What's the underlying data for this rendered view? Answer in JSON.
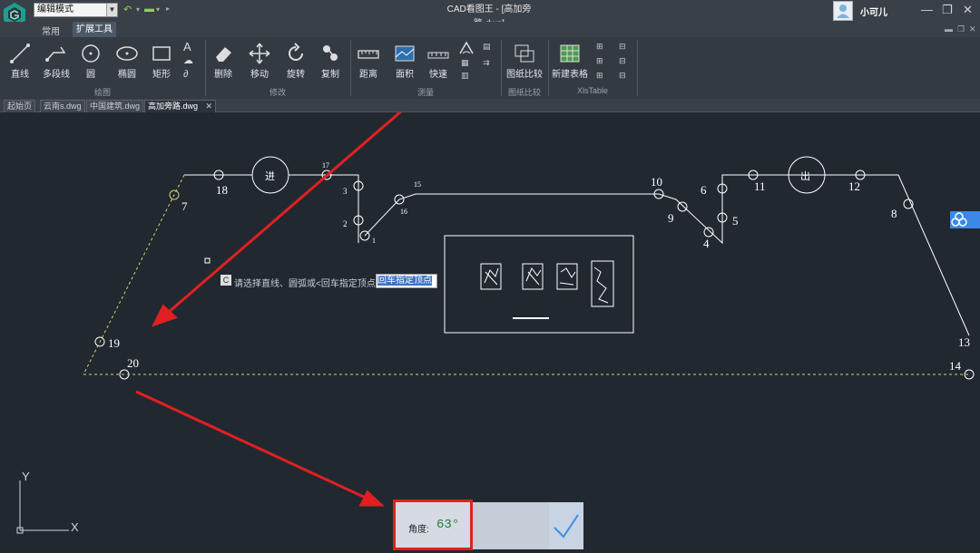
{
  "titlebar": {
    "mode_select": "编辑模式",
    "document_title": "CAD看图王 - [高加旁路.dwg]",
    "user_name": "小可儿"
  },
  "menu_tabs": [
    {
      "label": "常用"
    },
    {
      "label": "扩展工具"
    }
  ],
  "ribbon": {
    "draw_tools": [
      "直线",
      "多段线",
      "圆",
      "椭圆",
      "矩形"
    ],
    "modify_tools": [
      "删除",
      "移动",
      "旋转",
      "复制"
    ],
    "measure_tools": [
      "距离",
      "面积",
      "快速"
    ],
    "compare_tools": [
      "图纸比较"
    ],
    "table_tools": [
      "新建表格"
    ],
    "groups": [
      "绘图",
      "修改",
      "测量",
      "图纸比较",
      "XlsTable"
    ]
  },
  "document_tabs": [
    "起始页",
    "云南s.dwg",
    "中国建筑.dwg",
    "高加旁路.dwg"
  ],
  "drawing": {
    "entry_label": "进",
    "exit_label": "出",
    "point_labels": [
      "1",
      "2",
      "3",
      "4",
      "5",
      "6",
      "7",
      "8",
      "9",
      "10",
      "11",
      "12",
      "13",
      "14",
      "15",
      "16",
      "17",
      "18",
      "19",
      "20"
    ]
  },
  "prompt": {
    "text": "请选择直线、圆弧或<回车指定顶点>",
    "input": "回车指定顶点"
  },
  "result": {
    "angle_label": "角度:",
    "angle_value": "63°"
  },
  "axes": {
    "y": "Y",
    "x": "X"
  },
  "colors": {
    "canvas": "#212830",
    "highlight_red": "#e02020",
    "accent_blue": "#3b88e6",
    "dashed_yellow": "#d8d26a"
  }
}
